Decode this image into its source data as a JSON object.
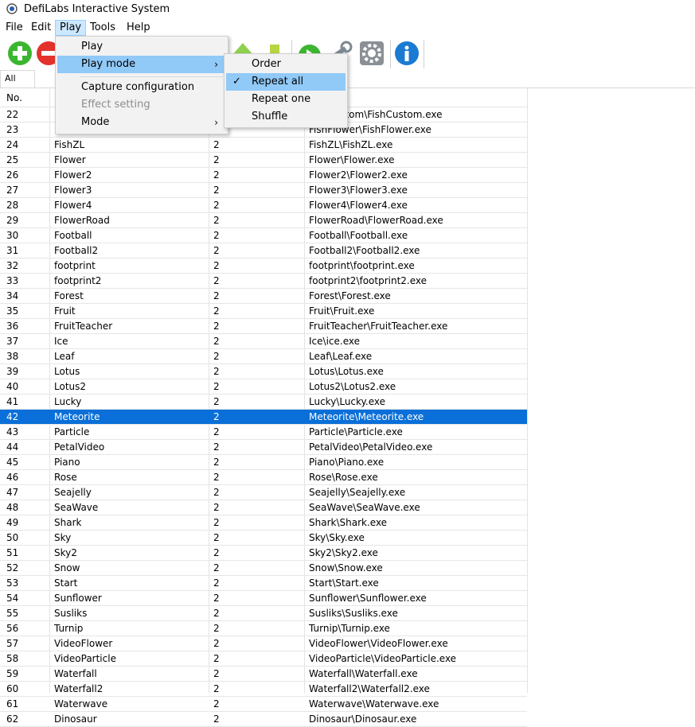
{
  "window": {
    "title": "DefiLabs Interactive System"
  },
  "menubar": {
    "file": "File",
    "edit": "Edit",
    "play": "Play",
    "tools": "Tools",
    "help": "Help"
  },
  "tabs": {
    "all": "All"
  },
  "grid": {
    "header_no": "No.",
    "rows": [
      [
        "22",
        "",
        "",
        "FishCustom\\FishCustom.exe"
      ],
      [
        "23",
        "",
        "",
        "FishFlower\\FishFlower.exe"
      ],
      [
        "24",
        "FishZL",
        "2",
        "FishZL\\FishZL.exe"
      ],
      [
        "25",
        "Flower",
        "2",
        "Flower\\Flower.exe"
      ],
      [
        "26",
        "Flower2",
        "2",
        "Flower2\\Flower2.exe"
      ],
      [
        "27",
        "Flower3",
        "2",
        "Flower3\\Flower3.exe"
      ],
      [
        "28",
        "Flower4",
        "2",
        "Flower4\\Flower4.exe"
      ],
      [
        "29",
        "FlowerRoad",
        "2",
        "FlowerRoad\\FlowerRoad.exe"
      ],
      [
        "30",
        "Football",
        "2",
        "Football\\Football.exe"
      ],
      [
        "31",
        "Football2",
        "2",
        "Football2\\Football2.exe"
      ],
      [
        "32",
        "footprint",
        "2",
        "footprint\\footprint.exe"
      ],
      [
        "33",
        "footprint2",
        "2",
        "footprint2\\footprint2.exe"
      ],
      [
        "34",
        "Forest",
        "2",
        "Forest\\Forest.exe"
      ],
      [
        "35",
        "Fruit",
        "2",
        "Fruit\\Fruit.exe"
      ],
      [
        "36",
        "FruitTeacher",
        "2",
        "FruitTeacher\\FruitTeacher.exe"
      ],
      [
        "37",
        "Ice",
        "2",
        "Ice\\ice.exe"
      ],
      [
        "38",
        "Leaf",
        "2",
        "Leaf\\Leaf.exe"
      ],
      [
        "39",
        "Lotus",
        "2",
        "Lotus\\Lotus.exe"
      ],
      [
        "40",
        "Lotus2",
        "2",
        "Lotus2\\Lotus2.exe"
      ],
      [
        "41",
        "Lucky",
        "2",
        "Lucky\\Lucky.exe"
      ],
      [
        "42",
        "Meteorite",
        "2",
        "Meteorite\\Meteorite.exe"
      ],
      [
        "43",
        "Particle",
        "2",
        "Particle\\Particle.exe"
      ],
      [
        "44",
        "PetalVideo",
        "2",
        "PetalVideo\\PetalVideo.exe"
      ],
      [
        "45",
        "Piano",
        "2",
        "Piano\\Piano.exe"
      ],
      [
        "46",
        "Rose",
        "2",
        "Rose\\Rose.exe"
      ],
      [
        "47",
        "Seajelly",
        "2",
        "Seajelly\\Seajelly.exe"
      ],
      [
        "48",
        "SeaWave",
        "2",
        "SeaWave\\SeaWave.exe"
      ],
      [
        "49",
        "Shark",
        "2",
        "Shark\\Shark.exe"
      ],
      [
        "50",
        "Sky",
        "2",
        "Sky\\Sky.exe"
      ],
      [
        "51",
        "Sky2",
        "2",
        "Sky2\\Sky2.exe"
      ],
      [
        "52",
        "Snow",
        "2",
        "Snow\\Snow.exe"
      ],
      [
        "53",
        "Start",
        "2",
        "Start\\Start.exe"
      ],
      [
        "54",
        "Sunflower",
        "2",
        "Sunflower\\Sunflower.exe"
      ],
      [
        "55",
        "Susliks",
        "2",
        "Susliks\\Susliks.exe"
      ],
      [
        "56",
        "Turnip",
        "2",
        "Turnip\\Turnip.exe"
      ],
      [
        "57",
        "VideoFlower",
        "2",
        "VideoFlower\\VideoFlower.exe"
      ],
      [
        "58",
        "VideoParticle",
        "2",
        "VideoParticle\\VideoParticle.exe"
      ],
      [
        "59",
        "Waterfall",
        "2",
        "Waterfall\\Waterfall.exe"
      ],
      [
        "60",
        "Waterfall2",
        "2",
        "Waterfall2\\Waterfall2.exe"
      ],
      [
        "61",
        "Waterwave",
        "2",
        "Waterwave\\Waterwave.exe"
      ],
      [
        "62",
        "Dinosaur",
        "2",
        "Dinosaur\\Dinosaur.exe"
      ]
    ],
    "selected_no": "42"
  },
  "play_menu": {
    "play": "Play",
    "play_mode": "Play mode",
    "capture_configuration": "Capture configuration",
    "effect_setting": "Effect setting",
    "mode": "Mode"
  },
  "play_mode_menu": {
    "order": "Order",
    "repeat_all": "Repeat all",
    "repeat_one": "Repeat one",
    "shuffle": "Shuffle",
    "checked": "Repeat all"
  },
  "toolbar_icons": [
    "add-icon",
    "remove-icon",
    "up-arrow-icon",
    "stop-icon",
    "play-icon",
    "tools-icon",
    "settings-icon",
    "info-icon"
  ],
  "colors": {
    "selection": "#0a6fd8",
    "menu_highlight": "#91c9f7",
    "menubar_active": "#cce8ff"
  }
}
